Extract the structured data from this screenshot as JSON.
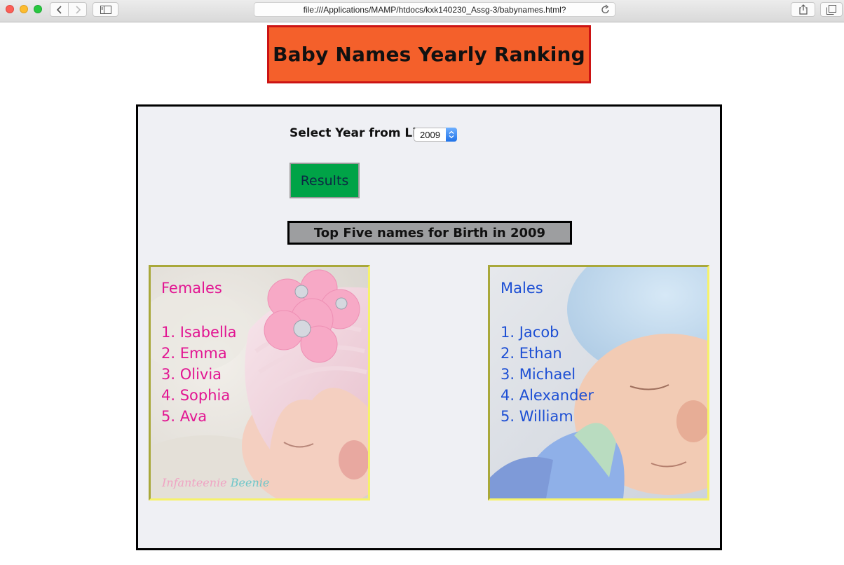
{
  "browser": {
    "url": "file:///Applications/MAMP/htdocs/kxk140230_Assg-3/babynames.html?"
  },
  "page": {
    "title": "Baby Names Yearly Ranking",
    "year_label": "Select Year from List:",
    "selected_year": "2009",
    "results_button": "Results",
    "top_five_heading": "Top Five names for Birth in 2009"
  },
  "females": {
    "heading": "Females",
    "names": [
      "1. Isabella",
      "2. Emma",
      "3. Olivia",
      "4. Sophia",
      "5. Ava"
    ],
    "watermark_part1": "Infanteenie",
    "watermark_part2": "Beenie"
  },
  "males": {
    "heading": "Males",
    "names": [
      "1. Jacob",
      "2. Ethan",
      "3. Michael",
      "4. Alexander",
      "5. William"
    ]
  },
  "colors": {
    "banner_bg": "#f4602b",
    "banner_border": "#cc1313",
    "female_text": "#e21592",
    "male_text": "#1d4fd4",
    "results_bg": "#00a347"
  },
  "icons": [
    "back-arrow-icon",
    "forward-arrow-icon",
    "sidebar-icon",
    "reload-icon",
    "share-icon",
    "tabs-icon",
    "select-stepper-icon"
  ]
}
